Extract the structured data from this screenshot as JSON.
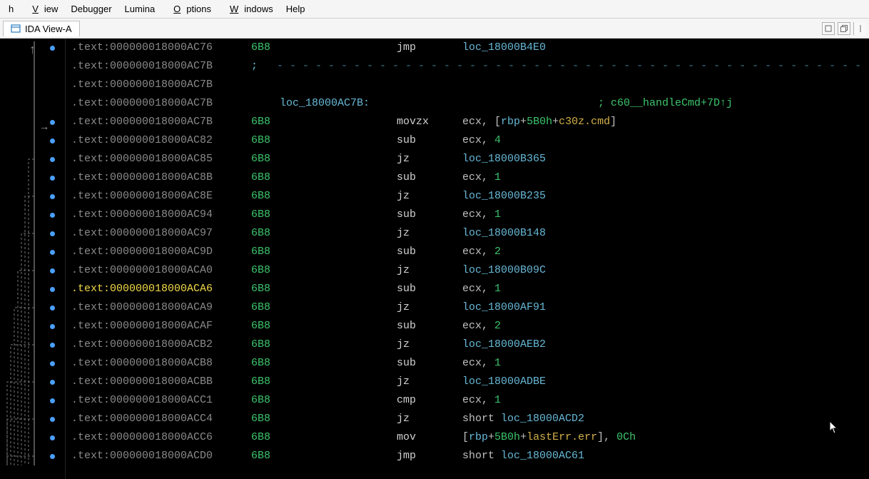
{
  "menu": {
    "items": [
      "h",
      "View",
      "Debugger",
      "Lumina",
      "Options",
      "Windows",
      "Help"
    ],
    "underlines": [
      "",
      "V",
      "",
      "",
      "O",
      "W",
      ""
    ]
  },
  "tab": {
    "title": "IDA View-A"
  },
  "colors": {
    "bg": "#000000",
    "loc": "#66b8d6",
    "num": "#3cc46b",
    "hl": "#f1d84a"
  },
  "lines": [
    {
      "addr": "000000018000AC76",
      "sp": "6B8",
      "mn": "jmp",
      "ops": [
        {
          "t": "loc",
          "v": "loc_18000B4E0"
        }
      ],
      "dot": 1
    },
    {
      "addr": "000000018000AC7B",
      "raw_comment": true,
      "dash_count": 120
    },
    {
      "addr": "000000018000AC7B"
    },
    {
      "addr": "000000018000AC7B",
      "locdef": "loc_18000AC7B:",
      "xref": "; c60__handleCmd+7D↑j"
    },
    {
      "addr": "000000018000AC7B",
      "sp": "6B8",
      "mn": "movzx",
      "ops": [
        {
          "t": "reg",
          "v": "ecx"
        },
        {
          "t": "p",
          "v": ", ["
        },
        {
          "t": "reg2",
          "v": "rbp"
        },
        {
          "t": "p",
          "v": "+"
        },
        {
          "t": "num",
          "v": "5B0h"
        },
        {
          "t": "p",
          "v": "+"
        },
        {
          "t": "mem",
          "v": "c30z.cmd"
        },
        {
          "t": "p",
          "v": "]"
        }
      ],
      "dot": 1,
      "arrow_in": true
    },
    {
      "addr": "000000018000AC82",
      "sp": "6B8",
      "mn": "sub",
      "ops": [
        {
          "t": "reg",
          "v": "ecx"
        },
        {
          "t": "p",
          "v": ", "
        },
        {
          "t": "num",
          "v": "4"
        }
      ],
      "dot": 1
    },
    {
      "addr": "000000018000AC85",
      "sp": "6B8",
      "mn": "jz",
      "ops": [
        {
          "t": "loc",
          "v": "loc_18000B365"
        }
      ],
      "dot": 1
    },
    {
      "addr": "000000018000AC8B",
      "sp": "6B8",
      "mn": "sub",
      "ops": [
        {
          "t": "reg",
          "v": "ecx"
        },
        {
          "t": "p",
          "v": ", "
        },
        {
          "t": "num",
          "v": "1"
        }
      ],
      "dot": 1
    },
    {
      "addr": "000000018000AC8E",
      "sp": "6B8",
      "mn": "jz",
      "ops": [
        {
          "t": "loc",
          "v": "loc_18000B235"
        }
      ],
      "dot": 1
    },
    {
      "addr": "000000018000AC94",
      "sp": "6B8",
      "mn": "sub",
      "ops": [
        {
          "t": "reg",
          "v": "ecx"
        },
        {
          "t": "p",
          "v": ", "
        },
        {
          "t": "num",
          "v": "1"
        }
      ],
      "dot": 1
    },
    {
      "addr": "000000018000AC97",
      "sp": "6B8",
      "mn": "jz",
      "ops": [
        {
          "t": "loc",
          "v": "loc_18000B148"
        }
      ],
      "dot": 1
    },
    {
      "addr": "000000018000AC9D",
      "sp": "6B8",
      "mn": "sub",
      "ops": [
        {
          "t": "reg",
          "v": "ecx"
        },
        {
          "t": "p",
          "v": ", "
        },
        {
          "t": "num",
          "v": "2"
        }
      ],
      "dot": 1
    },
    {
      "addr": "000000018000ACA0",
      "sp": "6B8",
      "mn": "jz",
      "ops": [
        {
          "t": "loc",
          "v": "loc_18000B09C"
        }
      ],
      "dot": 1
    },
    {
      "addr": "000000018000ACA6",
      "sp": "6B8",
      "mn": "sub",
      "ops": [
        {
          "t": "reg",
          "v": "ecx"
        },
        {
          "t": "p",
          "v": ", "
        },
        {
          "t": "num",
          "v": "1"
        }
      ],
      "dot": 1,
      "hl": true
    },
    {
      "addr": "000000018000ACA9",
      "sp": "6B8",
      "mn": "jz",
      "ops": [
        {
          "t": "loc",
          "v": "loc_18000AF91"
        }
      ],
      "dot": 1
    },
    {
      "addr": "000000018000ACAF",
      "sp": "6B8",
      "mn": "sub",
      "ops": [
        {
          "t": "reg",
          "v": "ecx"
        },
        {
          "t": "p",
          "v": ", "
        },
        {
          "t": "num",
          "v": "2"
        }
      ],
      "dot": 1
    },
    {
      "addr": "000000018000ACB2",
      "sp": "6B8",
      "mn": "jz",
      "ops": [
        {
          "t": "loc",
          "v": "loc_18000AEB2"
        }
      ],
      "dot": 1
    },
    {
      "addr": "000000018000ACB8",
      "sp": "6B8",
      "mn": "sub",
      "ops": [
        {
          "t": "reg",
          "v": "ecx"
        },
        {
          "t": "p",
          "v": ", "
        },
        {
          "t": "num",
          "v": "1"
        }
      ],
      "dot": 1
    },
    {
      "addr": "000000018000ACBB",
      "sp": "6B8",
      "mn": "jz",
      "ops": [
        {
          "t": "loc",
          "v": "loc_18000ADBE"
        }
      ],
      "dot": 1
    },
    {
      "addr": "000000018000ACC1",
      "sp": "6B8",
      "mn": "cmp",
      "ops": [
        {
          "t": "reg",
          "v": "ecx"
        },
        {
          "t": "p",
          "v": ", "
        },
        {
          "t": "num",
          "v": "1"
        }
      ],
      "dot": 1
    },
    {
      "addr": "000000018000ACC4",
      "sp": "6B8",
      "mn": "jz",
      "ops": [
        {
          "t": "short",
          "v": "short "
        },
        {
          "t": "loc",
          "v": "loc_18000ACD2"
        }
      ],
      "dot": 1
    },
    {
      "addr": "000000018000ACC6",
      "sp": "6B8",
      "mn": "mov",
      "ops": [
        {
          "t": "p",
          "v": "["
        },
        {
          "t": "reg2",
          "v": "rbp"
        },
        {
          "t": "p",
          "v": "+"
        },
        {
          "t": "num",
          "v": "5B0h"
        },
        {
          "t": "p",
          "v": "+"
        },
        {
          "t": "mem",
          "v": "lastErr.err"
        },
        {
          "t": "p",
          "v": "], "
        },
        {
          "t": "num",
          "v": "0Ch"
        }
      ],
      "dot": 1
    },
    {
      "addr": "000000018000ACD0",
      "sp": "6B8",
      "mn": "jmp",
      "ops": [
        {
          "t": "short",
          "v": "short "
        },
        {
          "t": "loc",
          "v": "loc_18000AC61"
        }
      ],
      "dot": 1
    }
  ],
  "strings": {
    "segment_prefix": ".text:"
  }
}
